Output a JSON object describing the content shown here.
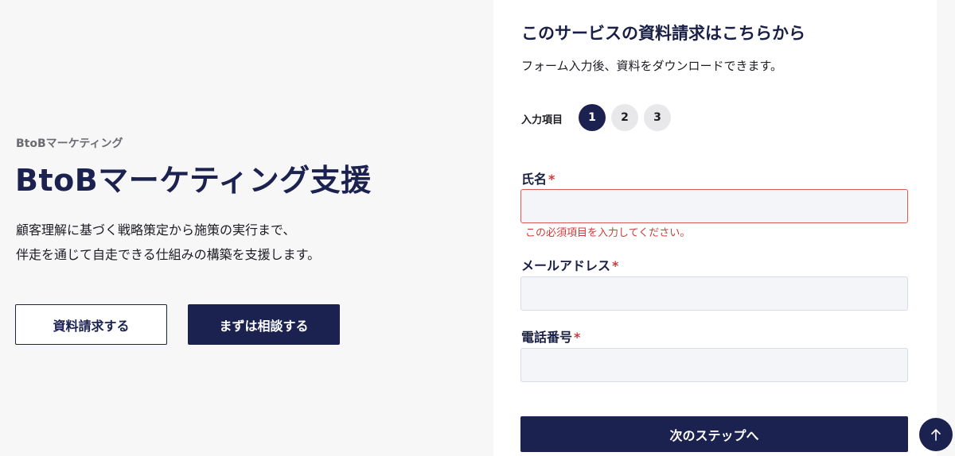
{
  "hero": {
    "eyebrow": "BtoBマーケティング",
    "title": "BtoBマーケティング支援",
    "description_lines": [
      "顧客理解に基づく戦略策定から施策の実行まで、",
      "伴走を通じて自走できる仕組みの構築を支援します。"
    ],
    "buttons": {
      "request_docs": "資料請求する",
      "consult": "まずは相談する"
    }
  },
  "form": {
    "title": "このサービスの資料請求はこちらから",
    "subtitle": "フォーム入力後、資料をダウンロードできます。",
    "steps_label": "入力項目",
    "steps": [
      "1",
      "2",
      "3"
    ],
    "active_step": "1",
    "required_mark": "*",
    "fields": [
      {
        "label": "氏名",
        "value": "",
        "error": "この必須項目を入力してください。"
      },
      {
        "label": "メールアドレス",
        "value": ""
      },
      {
        "label": "電話番号",
        "value": ""
      }
    ],
    "next_label": "次のステップへ"
  },
  "scroll_top": {
    "icon": "arrow-up-icon"
  },
  "colors": {
    "navy": "#1c2250",
    "error": "#d23a3a",
    "page_bg": "#f7f7f8",
    "input_bg": "#f4f5f8"
  }
}
